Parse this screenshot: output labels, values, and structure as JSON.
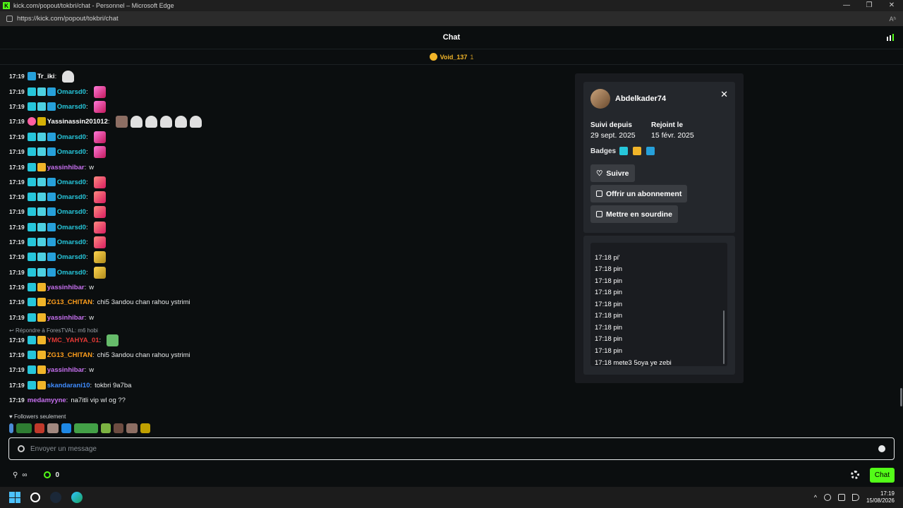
{
  "browser": {
    "window_title": "kick.com/popout/tokbri/chat - Personnel – Microsoft Edge",
    "url": "https://kick.com/popout/tokbri/chat",
    "reader_label": "Aʰ"
  },
  "header": {
    "title": "Chat"
  },
  "pinned": {
    "name": "Void_137",
    "count": "1"
  },
  "messages": [
    {
      "time": "17:19",
      "user": "Tr_iki",
      "color": "#ffffff",
      "text": ""
    },
    {
      "time": "17:19",
      "user": "Omarsd0",
      "color": "#26c6da",
      "text": ""
    },
    {
      "time": "17:19",
      "user": "Omarsd0",
      "color": "#26c6da",
      "text": ""
    },
    {
      "time": "17:19",
      "user": "Yassinassin201012",
      "color": "#ffffff",
      "text": ""
    },
    {
      "time": "17:19",
      "user": "Omarsd0",
      "color": "#26c6da",
      "text": ""
    },
    {
      "time": "17:19",
      "user": "Omarsd0",
      "color": "#26c6da",
      "text": ""
    },
    {
      "time": "17:19",
      "user": "yassinhibar",
      "color": "#c770f0",
      "text": "w"
    },
    {
      "time": "17:19",
      "user": "Omarsd0",
      "color": "#26c6da",
      "text": ""
    },
    {
      "time": "17:19",
      "user": "Omarsd0",
      "color": "#26c6da",
      "text": ""
    },
    {
      "time": "17:19",
      "user": "Omarsd0",
      "color": "#26c6da",
      "text": ""
    },
    {
      "time": "17:19",
      "user": "Omarsd0",
      "color": "#26c6da",
      "text": ""
    },
    {
      "time": "17:19",
      "user": "Omarsd0",
      "color": "#26c6da",
      "text": ""
    },
    {
      "time": "17:19",
      "user": "Omarsd0",
      "color": "#26c6da",
      "text": ""
    },
    {
      "time": "17:19",
      "user": "Omarsd0",
      "color": "#26c6da",
      "text": ""
    },
    {
      "time": "17:19",
      "user": "yassinhibar",
      "color": "#c770f0",
      "text": "w"
    },
    {
      "time": "17:19",
      "user": "ZG13_CHITAN",
      "color": "#ff9f1c",
      "text": "chi5 3andou chan rahou ystrimi"
    },
    {
      "time": "17:19",
      "user": "yassinhibar",
      "color": "#c770f0",
      "text": "w"
    },
    {
      "time": "17:19",
      "user": "YMC_YAHYA_01",
      "color": "#e53935",
      "text": ""
    },
    {
      "time": "17:19",
      "user": "ZG13_CHITAN",
      "color": "#ff9f1c",
      "text": "chi5 3andou chan rahou ystrimi"
    },
    {
      "time": "17:19",
      "user": "yassinhibar",
      "color": "#c770f0",
      "text": "w"
    },
    {
      "time": "17:19",
      "user": "skandarani10",
      "color": "#3f8cff",
      "text": "tokbri 9a7ba"
    },
    {
      "time": "17:19",
      "user": "medamyyne",
      "color": "#c770f0",
      "text": "na7itli vip wl og ??"
    }
  ],
  "reply_text": "Répondre à ForesTVAL: m6 hobi",
  "followers_only": "Followers seulement",
  "input": {
    "placeholder": "Envoyer un message"
  },
  "footer": {
    "infinity": "∞",
    "points": "0",
    "chat_button": "Chat"
  },
  "usercard": {
    "username": "Abdelkader74",
    "followed_label": "Suivi depuis",
    "followed_value": "29 sept. 2025",
    "joined_label": "Rejoint le",
    "joined_value": "15 févr. 2025",
    "badges_label": "Badges",
    "follow_button": "Suivre",
    "gift_button": "Offrir un abonnement",
    "mute_button": "Mettre en sourdine",
    "history": [
      "17:18 pi'",
      "17:18 pin",
      "17:18 pin",
      "17:18 pin",
      "17:18 pin",
      "17:18 pin",
      "17:18 pin",
      "17:18 pin",
      "17:18 pin",
      "17:18 mete3 5oya ye zebi"
    ]
  },
  "taskbar": {
    "time": "17:19",
    "date": "15/08/2026"
  }
}
